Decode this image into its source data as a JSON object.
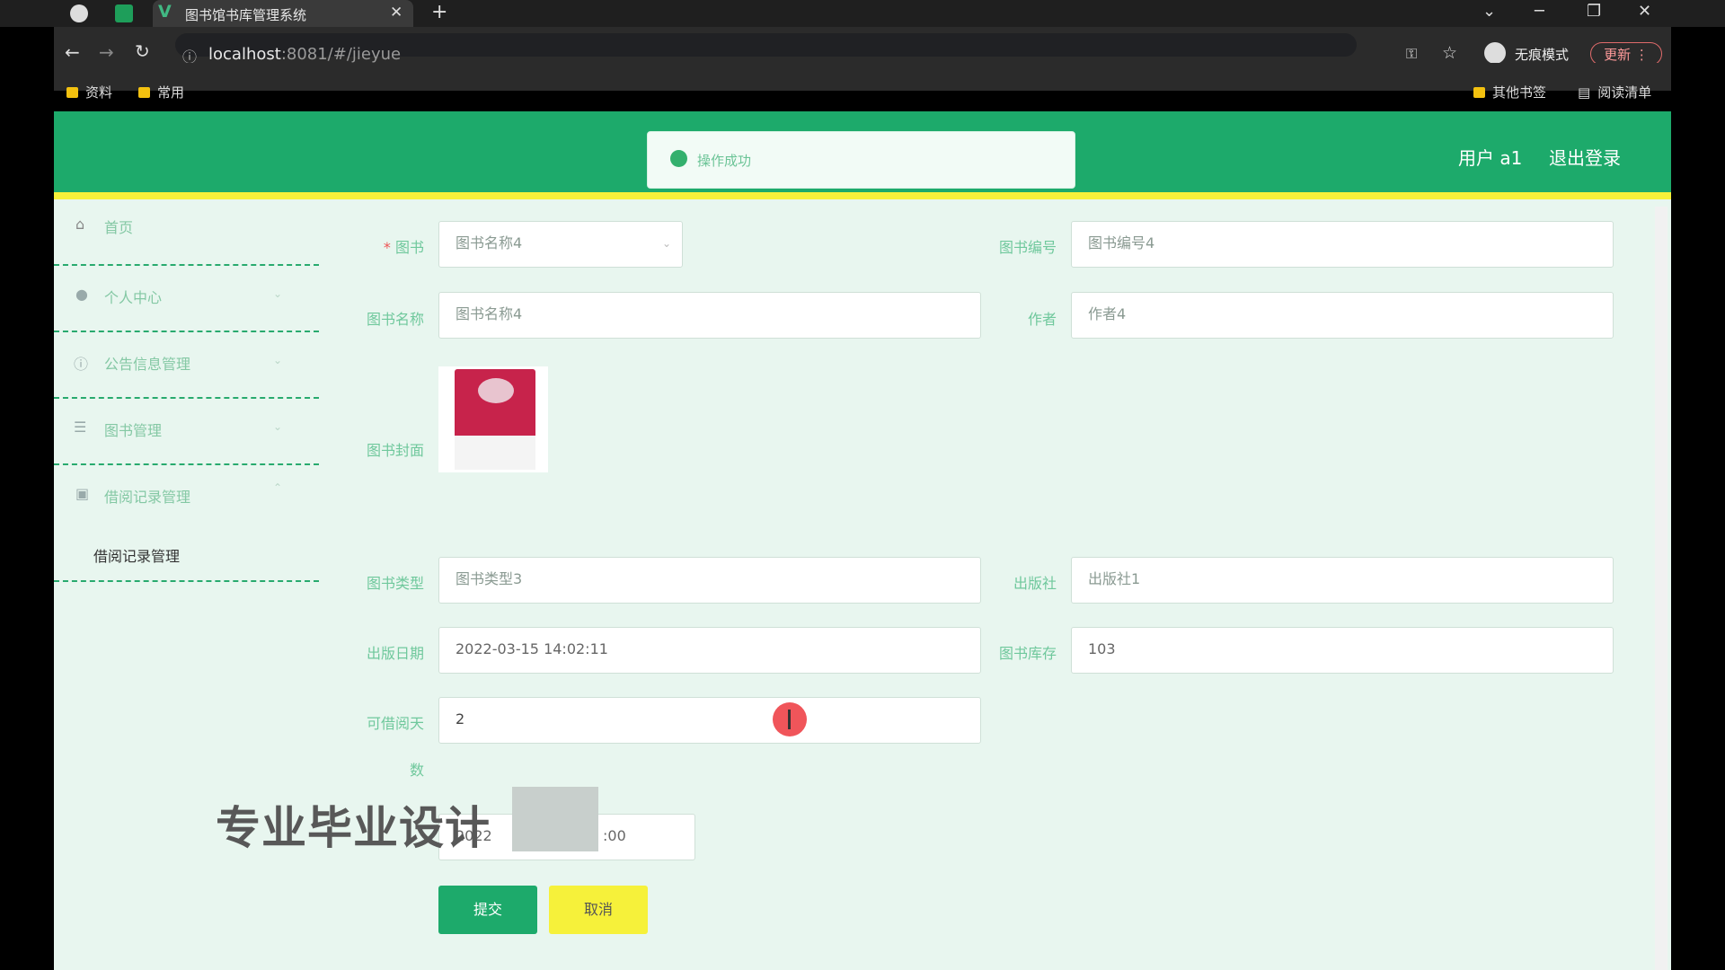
{
  "browser": {
    "tab_title": "图书馆书库管理系统",
    "url_host": "localhost",
    "url_path": ":8081/#/jieyue",
    "bookmarks": [
      "资料",
      "常用"
    ],
    "bookmarks_right": [
      "其他书签",
      "阅读清单"
    ],
    "incognito_label": "无痕模式",
    "update_label": "更新"
  },
  "header": {
    "toast": "操作成功",
    "user": "用户 a1",
    "logout": "退出登录"
  },
  "sidebar": {
    "items": [
      {
        "label": "首页",
        "icon": "home-icon"
      },
      {
        "label": "个人中心",
        "icon": "user-icon"
      },
      {
        "label": "公告信息管理",
        "icon": "info-icon"
      },
      {
        "label": "图书管理",
        "icon": "list-icon"
      },
      {
        "label": "借阅记录管理",
        "icon": "clipboard-icon"
      }
    ],
    "subitem": "借阅记录管理"
  },
  "form": {
    "book_label": "图书",
    "book_select": "图书名称4",
    "book_no_label": "图书编号",
    "book_no_value": "图书编号4",
    "book_name_label": "图书名称",
    "book_name_value": "图书名称4",
    "author_label": "作者",
    "author_value": "作者4",
    "cover_label": "图书封面",
    "type_label": "图书类型",
    "type_value": "图书类型3",
    "publisher_label": "出版社",
    "publisher_value": "出版社1",
    "pub_date_label": "出版日期",
    "pub_date_value": "2022-03-15 14:02:11",
    "stock_label": "图书库存",
    "stock_value": "103",
    "borrow_days_label": "可借阅天",
    "borrow_days_label2": "数",
    "borrow_days_value": "2",
    "borrow_time_value_start": "2022",
    "borrow_time_value_end": ":00",
    "submit": "提交",
    "cancel": "取消"
  },
  "overlay": {
    "watermark": "专业毕业设计"
  },
  "colors": {
    "header_green": "#1daa6b",
    "accent_yellow": "#f6f13a",
    "page_bg": "#e8f6ef"
  }
}
